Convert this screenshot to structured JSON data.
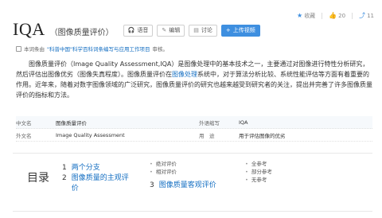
{
  "top_actions": {
    "favorite": {
      "icon": "star-icon",
      "label": "收藏"
    },
    "like": {
      "icon": "thumbs-up-icon",
      "count": "20"
    },
    "share": {
      "icon": "share-icon",
      "count": "11"
    }
  },
  "title": {
    "main": "IQA",
    "sub": "（图像质量评价）"
  },
  "buttons": [
    {
      "icon": "audio-icon",
      "label": "语音"
    },
    {
      "icon": "edit-icon",
      "label": "编辑"
    },
    {
      "icon": "discuss-icon",
      "label": "讨论"
    },
    {
      "icon": "upload-icon",
      "label": "上传视频"
    }
  ],
  "source": {
    "prefix": "本词条由",
    "link": "\"科普中国\"科学百科词条编写与应用工作项目",
    "suffix": "审核。"
  },
  "paragraph": {
    "part1": "图像质量评价（Image Quality Assessment,IQA）是图像处理中的基本技术之一，主要通过对图像进行特性分析研究，然后评估出图像优劣（图像失真程度）。图像质量评价在",
    "link": "图像处理",
    "part2": "系统中，对于算法分析比较、系统性能评估等方面有着重要的作用。近年来，随着对数字图像领域的广泛研究，图像质量评价的研究也越来越受到研究者的关注，提出并完善了许多图像质量评价的指标和方法。"
  },
  "info": [
    {
      "k1": "中文名",
      "v1": "图像质量评价",
      "k2": "外语缩写",
      "v2": "IQA"
    },
    {
      "k1": "外文名",
      "v1": "Image Quality Assessment",
      "k2": "用　途",
      "v2": "用于评估图像的优劣"
    }
  ],
  "toc": {
    "label": "目录",
    "col1": [
      {
        "num": "1",
        "text": "两个分支"
      },
      {
        "num": "2",
        "text": "图像质量的主观评价"
      }
    ],
    "col2_subs": [
      "绝对评价",
      "相对评价"
    ],
    "col2_items": [
      {
        "num": "3",
        "text": "图像质量客观评价"
      }
    ],
    "col3_subs": [
      "全参考",
      "部分参考",
      "无参考"
    ]
  },
  "colors": {
    "accent": "#3e8fe0",
    "link": "#136ec2"
  }
}
